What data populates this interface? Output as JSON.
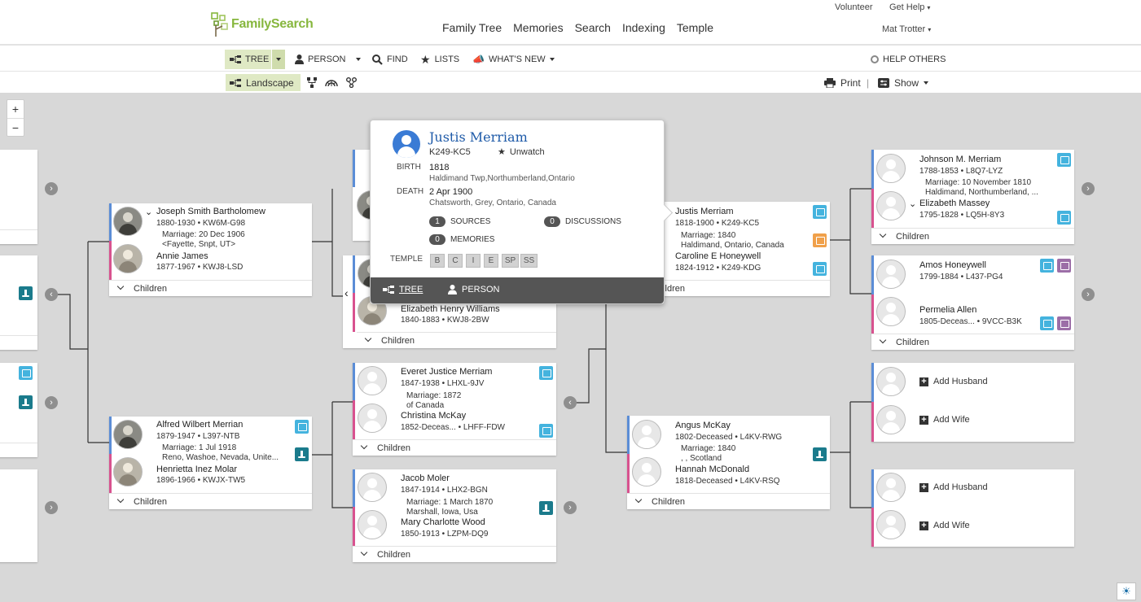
{
  "header": {
    "logo": "FamilySearch",
    "nav": [
      "Family Tree",
      "Memories",
      "Search",
      "Indexing",
      "Temple"
    ],
    "volunteer": "Volunteer",
    "get_help": "Get Help",
    "user": "Mat Trotter"
  },
  "toolbar": {
    "tree": "TREE",
    "person": "PERSON",
    "find": "FIND",
    "lists": "LISTS",
    "whats_new": "WHAT'S NEW",
    "help_others": "HELP OTHERS"
  },
  "viewbar": {
    "landscape": "Landscape",
    "print": "Print",
    "show": "Show"
  },
  "zoom": {
    "in": "+",
    "out": "−"
  },
  "children_label": "Children",
  "couples": {
    "joseph": {
      "husband": {
        "name": "Joseph Smith Bartholomew",
        "dates": "1880-1930 • KW6M-G98"
      },
      "marriage": "Marriage: 20 Dec 1906",
      "place": "<Fayette, Snpt, UT>",
      "wife": {
        "name": "Annie James",
        "dates": "1877-1967 • KWJ8-LSD"
      }
    },
    "alfred": {
      "husband": {
        "name": "Alfred Wilbert Merrian",
        "dates": "1879-1947 • L397-NTB"
      },
      "marriage": "Marriage: 1 Jul 1918",
      "place": "Reno, Washoe, Nevada, Unite...",
      "wife": {
        "name": "Henrietta Inez Molar",
        "dates": "1896-1966 • KWJX-TW5"
      }
    },
    "elizabeth_hw": {
      "wife": {
        "name": "Elizabeth Henry Williams",
        "dates": "1840-1883 • KWJ8-2BW"
      }
    },
    "everet": {
      "husband": {
        "name": "Everet Justice Merriam",
        "dates": "1847-1938 • LHXL-9JV"
      },
      "marriage": "Marriage: 1872",
      "place": "of Canada",
      "wife": {
        "name": "Christina McKay",
        "dates": "1852-Deceas...   • LHFF-FDW"
      }
    },
    "jacob": {
      "husband": {
        "name": "Jacob Moler",
        "dates": "1847-1914 • LHX2-BGN"
      },
      "marriage": "Marriage: 1 March 1870",
      "place": "Marshall, Iowa, Usa",
      "wife": {
        "name": "Mary Charlotte Wood",
        "dates": "1850-1913 • LZPM-DQ9"
      }
    },
    "justis": {
      "husband": {
        "name": "Justis Merriam",
        "dates": "1818-1900 • K249-KC5"
      },
      "marriage": "Marriage: 1840",
      "place": "Haldimand, Ontario, Canada",
      "wife": {
        "name": "Caroline E Honeywell",
        "dates": "1824-1912 • K249-KDG"
      }
    },
    "angus": {
      "husband": {
        "name": "Angus McKay",
        "dates": "1802-Deceased • L4KV-RWG"
      },
      "marriage": "Marriage: 1840",
      "place": ", , Scotland",
      "wife": {
        "name": "Hannah McDonald",
        "dates": "1818-Deceased • L4KV-RSQ"
      }
    },
    "johnson": {
      "husband": {
        "name": "Johnson M. Merriam",
        "dates": "1788-1853 • L8Q7-LYZ"
      },
      "marriage": "Marriage: 10 November 1810",
      "place": "Haldimand, Northumberland, ...",
      "wife": {
        "name": "Elizabeth Massey",
        "dates": "1795-1828 • LQ5H-8Y3"
      }
    },
    "amos": {
      "husband": {
        "name": "Amos Honeywell",
        "dates": "1799-1884 • L437-PG4"
      },
      "wife": {
        "name": "Permelia Allen",
        "dates": "1805-Deceas...   • 9VCC-B3K"
      }
    }
  },
  "add": {
    "husband": "Add Husband",
    "wife": "Add Wife"
  },
  "popup": {
    "name": "Justis Merriam",
    "pid": "K249-KC5",
    "unwatch": "Unwatch",
    "birth_label": "BIRTH",
    "birth_date": "1818",
    "birth_place": "Haldimand Twp,Northumberland,Ontario",
    "death_label": "DEATH",
    "death_date": "2 Apr 1900",
    "death_place": "Chatsworth, Grey, Ontario, Canada",
    "sources_count": "1",
    "sources": "SOURCES",
    "discussions_count": "0",
    "discussions": "DISCUSSIONS",
    "memories_count": "0",
    "memories": "MEMORIES",
    "temple_label": "TEMPLE",
    "ordinances": [
      "B",
      "C",
      "I",
      "E",
      "SP",
      "SS"
    ],
    "tree": "TREE",
    "person": "PERSON"
  },
  "colors": {
    "brand_green": "#87b73e",
    "male_bar": "#5b8dd6",
    "female_bar": "#d8528f",
    "name_link": "#1e5aa8"
  }
}
